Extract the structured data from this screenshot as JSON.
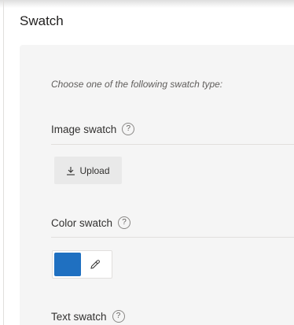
{
  "page": {
    "title": "Swatch"
  },
  "panel": {
    "instructions": "Choose one of the following swatch type:",
    "image_swatch": {
      "label": "Image swatch",
      "help": "?",
      "upload_label": "Upload"
    },
    "color_swatch": {
      "label": "Color swatch",
      "help": "?",
      "selected_color": "#1f70c1"
    },
    "text_swatch": {
      "label": "Text swatch",
      "help": "?"
    }
  },
  "icons": {
    "upload": "download-icon",
    "eyedropper": "eyedropper-icon",
    "help": "help-circle-icon"
  }
}
